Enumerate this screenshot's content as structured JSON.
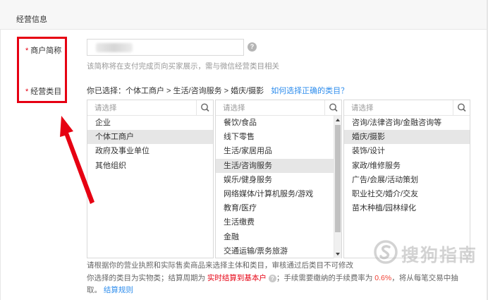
{
  "section": {
    "title": "经营信息"
  },
  "form": {
    "merchant_name": {
      "required_mark": "*",
      "label": "商户简称",
      "value": "",
      "help_icon": "question-icon",
      "hint": "该简称将在支付完成页向买家展示，需与微信经营类目相关"
    },
    "category": {
      "required_mark": "*",
      "label": "经营类目",
      "selected_prefix": "你已选择：",
      "selected_path": "个体工商户 > 生活/咨询服务 > 婚庆/摄影",
      "help_link": "如何选择正确的类目？"
    }
  },
  "selectors": {
    "level1": {
      "placeholder": "请选择",
      "items": [
        "企业",
        "个体工商户",
        "政府及事业单位",
        "其他组织"
      ],
      "selected": "个体工商户"
    },
    "level2": {
      "placeholder": "请选择",
      "items": [
        "餐饮/食品",
        "线下零售",
        "生活/家居用品",
        "生活/咨询服务",
        "娱乐/健身服务",
        "网络媒体/计算机服务/游戏",
        "教育/医疗",
        "生活缴费",
        "金融",
        "交通运输/票务旅游"
      ],
      "selected": "生活/咨询服务"
    },
    "level3": {
      "placeholder": "请选择",
      "items": [
        "咨询/法律咨询/金融咨询等",
        "婚庆/摄影",
        "装饰/设计",
        "家政/维修服务",
        "广告/会展/活动策划",
        "职业社交/婚介/交友",
        "苗木种植/园林绿化"
      ],
      "selected": "婚庆/摄影"
    }
  },
  "footer": {
    "line1": "请根据你的营业执照和实际售卖商品来选择主体和类目，审核通过后类目不可修改",
    "line2_prefix": "你选择的类目为实物类；结算周期为",
    "settlement": "实时结算到基本户",
    "line2_mid": "；手续需要缴纳的手续费率为",
    "rate": "0.6%",
    "line2_suffix": "，将从每笔交易中抽",
    "line3_prefix": "取。",
    "rules_link": "结算规则"
  },
  "watermark": {
    "text": "搜狗指南",
    "icon": "sogou-logo-icon"
  },
  "colors": {
    "required": "#e60012",
    "link": "#2e8ded",
    "annotation": "#e60012",
    "selected_bg": "#e6e6e6"
  }
}
